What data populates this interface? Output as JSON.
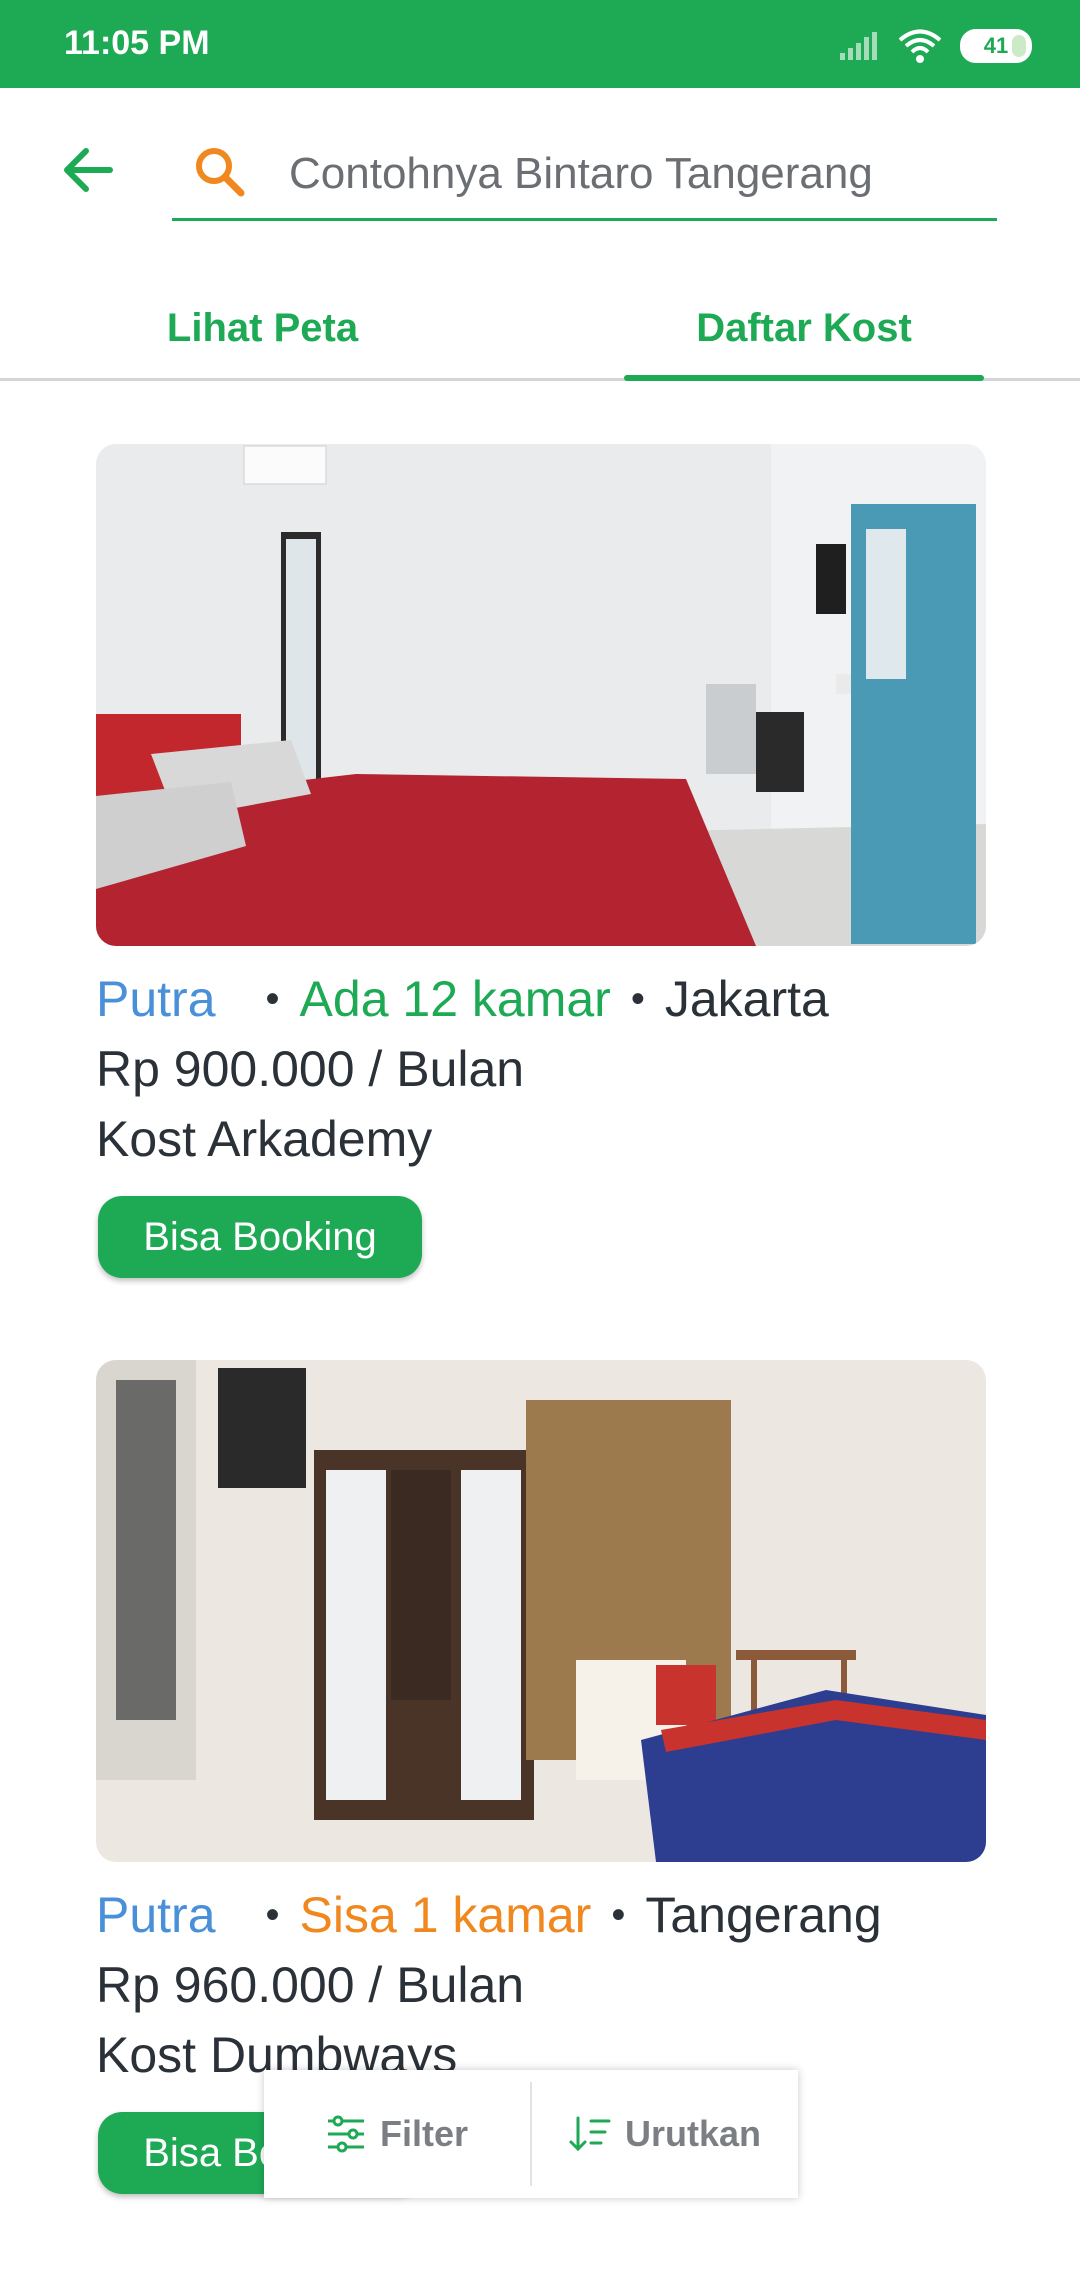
{
  "status_bar": {
    "time": "11:05 PM",
    "battery": "41"
  },
  "search": {
    "placeholder": "Contohnya Bintaro Tangerang"
  },
  "tabs": [
    {
      "label": "Lihat Peta"
    },
    {
      "label": "Daftar Kost"
    }
  ],
  "listings": [
    {
      "gender": "Putra",
      "availability": "Ada 12 kamar",
      "city": "Jakarta",
      "price": "Rp 900.000 / Bulan",
      "name": "Kost Arkademy",
      "button": "Bisa Booking"
    },
    {
      "gender": "Putra",
      "availability": "Sisa 1 kamar",
      "city": "Tangerang",
      "price": "Rp 960.000 / Bulan",
      "name": "Kost Dumbways",
      "button": "Bisa Booking"
    }
  ],
  "bottom_actions": {
    "filter": "Filter",
    "sort": "Urutkan"
  },
  "colors": {
    "brand": "#1eaa55",
    "accent_orange": "#f0881f",
    "gender_blue": "#4a90d9"
  }
}
